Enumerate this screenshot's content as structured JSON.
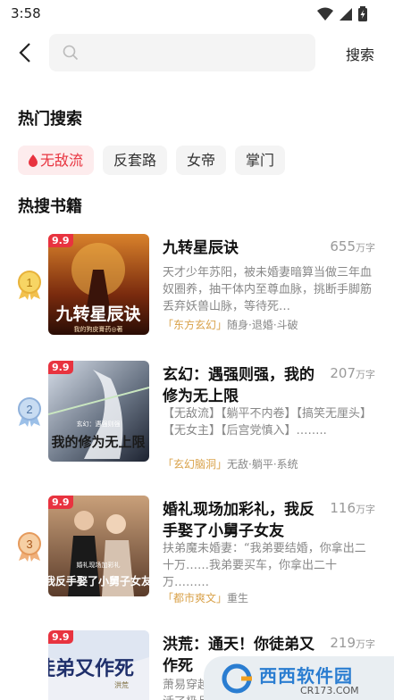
{
  "status_bar": {
    "time": "3:58"
  },
  "search": {
    "placeholder": "",
    "button_label": "搜索"
  },
  "hot_search": {
    "title": "热门搜索",
    "tags": [
      {
        "label": "无敌流",
        "hot": true
      },
      {
        "label": "反套路",
        "hot": false
      },
      {
        "label": "女帝",
        "hot": false
      },
      {
        "label": "掌门",
        "hot": false
      }
    ]
  },
  "hot_books": {
    "title": "热搜书籍",
    "items": [
      {
        "rank": "1",
        "badge": "9.9",
        "title": "九转星辰诀",
        "count": "655",
        "count_unit": "万字",
        "desc": "天才少年苏阳，被未婚妻暗算当做三年血奴圈养，抽干体内至尊血脉，挑断手脚筋丢弃妖兽山脉，等待死…",
        "category": "「东方玄幻」",
        "tags": "随身·退婚·斗破",
        "cover_text": "九转星辰诀",
        "cover_sub": "我的狗皮膏药◎著"
      },
      {
        "rank": "2",
        "badge": "9.9",
        "title": "玄幻：遇强则强，我的修为无上限",
        "count": "207",
        "count_unit": "万字",
        "desc": "【无敌流】【躺平不内卷】【搞笑无厘头】【无女主】【后宫党慎入】……..",
        "category": "「玄幻脑洞」",
        "tags": "无敌·躺平·系统",
        "cover_text": "我的修为无上限",
        "cover_sub": "玄幻：遇强则强"
      },
      {
        "rank": "3",
        "badge": "9.9",
        "title": "婚礼现场加彩礼，我反手娶了小舅子女友",
        "count": "116",
        "count_unit": "万字",
        "desc": "扶弟魔未婚妻：“我弟要结婚，你拿出二十万……我弟要买车，你拿出二十万………",
        "category": "「都市爽文」",
        "tags": "重生",
        "cover_text": "我反手娶了小舅子女友",
        "cover_sub": "婚礼现场加彩礼"
      },
      {
        "rank": "4",
        "badge": "9.9",
        "title": "洪荒：通天！你徒弟又作死",
        "count": "219",
        "count_unit": "万字",
        "desc": "萧易穿越洪荒，成为截教的初代人族，激活了极品免费…",
        "category": "",
        "tags": "",
        "cover_text": "你徒弟又作死",
        "cover_sub": "洪荒"
      }
    ]
  },
  "watermark": {
    "text": "西西软件园",
    "url": "CR173.COM"
  },
  "colors": {
    "accent": "#e8333f",
    "category": "#d9a24a",
    "muted": "#888888"
  }
}
